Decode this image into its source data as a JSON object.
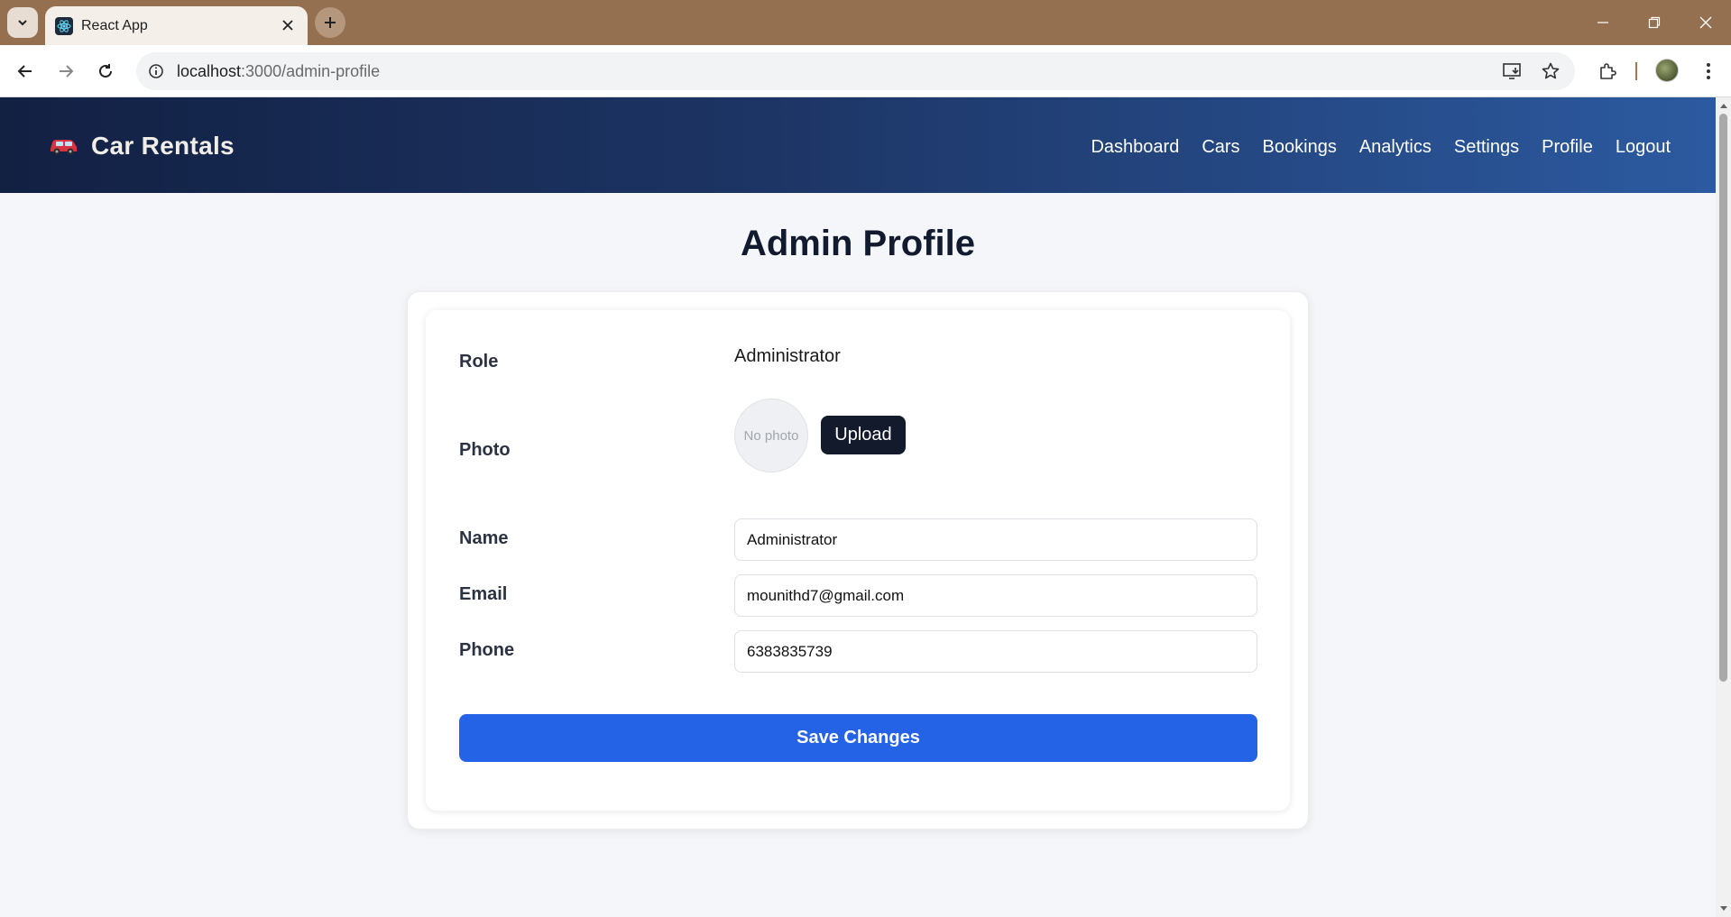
{
  "browser": {
    "tab_title": "React App",
    "url_host": "localhost",
    "url_path": ":3000/admin-profile"
  },
  "header": {
    "brand_name": "Car Rentals",
    "brand_icon": "car-icon",
    "nav": [
      "Dashboard",
      "Cars",
      "Bookings",
      "Analytics",
      "Settings",
      "Profile",
      "Logout"
    ]
  },
  "page": {
    "title": "Admin Profile"
  },
  "profile": {
    "role_label": "Role",
    "role_value": "Administrator",
    "photo_label": "Photo",
    "photo_placeholder": "No photo",
    "upload_label": "Upload",
    "name_label": "Name",
    "name_value": "Administrator",
    "email_label": "Email",
    "email_value": "mounithd7@gmail.com",
    "phone_label": "Phone",
    "phone_value": "6383835739",
    "save_label": "Save Changes"
  },
  "colors": {
    "header_gradient_start": "#122042",
    "header_gradient_end": "#2c5aa0",
    "primary_button": "#2463e6",
    "dark_button": "#121a2b",
    "tabstrip": "#957050"
  }
}
